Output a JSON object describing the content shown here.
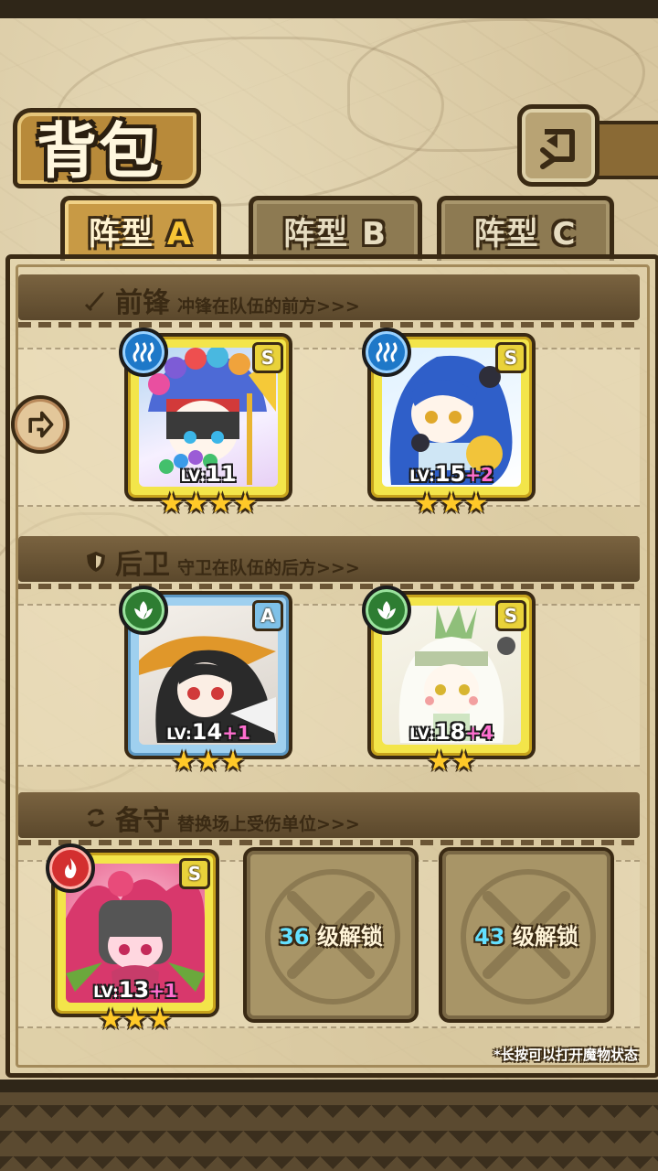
{
  "header": {
    "title": "背包"
  },
  "tabs": [
    {
      "label": "阵型",
      "suffix": "A",
      "active": true
    },
    {
      "label": "阵型",
      "suffix": "B",
      "active": false
    },
    {
      "label": "阵型",
      "suffix": "C",
      "active": false
    }
  ],
  "sections": {
    "front": {
      "name": "前锋",
      "desc": "冲锋在队伍的前方>>>"
    },
    "back": {
      "name": "后卫",
      "desc": "守卫在队伍的后方>>>"
    },
    "reserve": {
      "name": "备守",
      "desc": "替换场上受伤单位>>>"
    }
  },
  "units": {
    "front1": {
      "element": "water-icon",
      "rank": "S",
      "lv_prefix": "LV:",
      "level": "11",
      "bonus": "",
      "stars": 4
    },
    "front2": {
      "element": "water-icon",
      "rank": "S",
      "lv_prefix": "LV:",
      "level": "15",
      "bonus": "+2",
      "stars": 3
    },
    "back1": {
      "element": "leaf-icon",
      "rank": "A",
      "lv_prefix": "LV:",
      "level": "14",
      "bonus": "+1",
      "stars": 3
    },
    "back2": {
      "element": "leaf-icon",
      "rank": "S",
      "lv_prefix": "LV:",
      "level": "18",
      "bonus": "+4",
      "stars": 2
    },
    "reserve1": {
      "element": "fire-icon",
      "rank": "S",
      "lv_prefix": "LV:",
      "level": "13",
      "bonus": "+1",
      "stars": 3
    }
  },
  "locked_slots": [
    {
      "level": "36",
      "label": "级解锁"
    },
    {
      "level": "43",
      "label": "级解锁"
    }
  ],
  "footnote": "*长按可以打开魔物状态",
  "colors": {
    "water": "#1e78c8",
    "leaf": "#2e7d32",
    "fire": "#d32f2f",
    "bonus": "#ff6fd0",
    "unlock_level": "#63e0ff"
  }
}
